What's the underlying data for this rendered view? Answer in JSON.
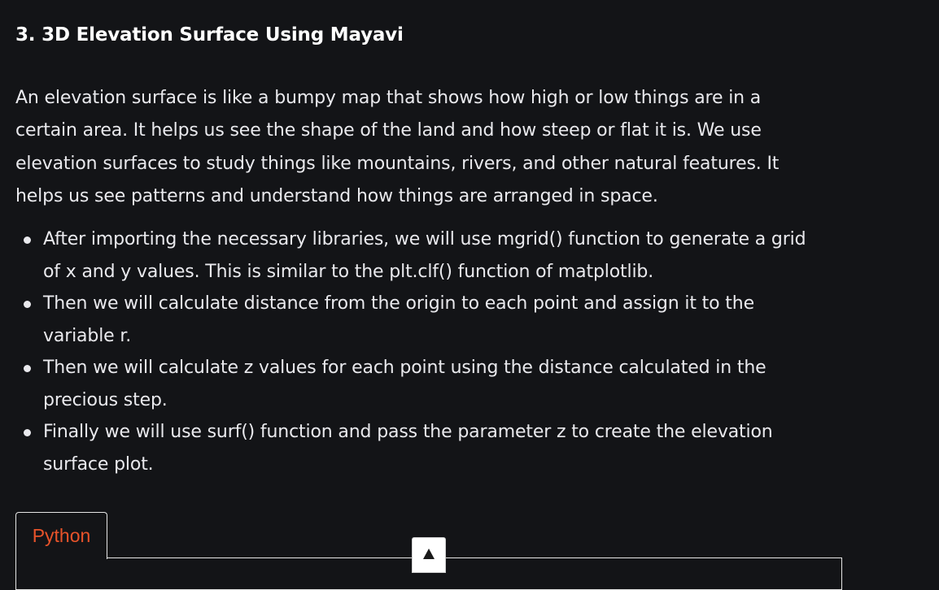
{
  "article": {
    "heading": "3. 3D Elevation Surface Using Mayavi",
    "intro": "An elevation surface is like a bumpy map that shows how high or low things are in a certain area. It helps us see the shape of the land and how steep or flat it is. We use elevation surfaces to study things like mountains, rivers, and other natural features. It helps us see patterns and understand how things are arranged in space.",
    "bullets": [
      "After importing the necessary libraries, we will use mgrid() function to generate a grid of x and y values. This is similar to the plt.clf() function of matplotlib.",
      "Then we will calculate distance from the origin to each point and assign it to the variable r.",
      "Then we will calculate z values for each point using the distance calculated in the precious step.",
      "Finally we will use surf() function and pass the parameter z to create the elevation surface plot."
    ]
  },
  "code": {
    "tab_label": "Python"
  },
  "icons": {
    "collapse": "triangle-up-icon"
  },
  "colors": {
    "background": "#131417",
    "text": "#e9e9ed",
    "tab_accent": "#e8532a"
  }
}
